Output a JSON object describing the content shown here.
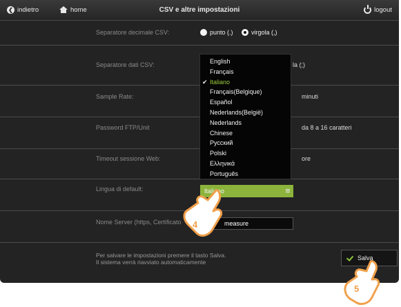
{
  "topbar": {
    "back_label": "indietro",
    "home_label": "home",
    "title": "CSV e altre impostazioni",
    "logout_label": "logout"
  },
  "settings": {
    "decimal_separator": {
      "label": "Separatore decimale CSV:",
      "options": [
        "punto (.)",
        "virgola (,)"
      ],
      "selected": "virgola (,)"
    },
    "data_separator": {
      "label": "Separatore dati CSV:",
      "value_suffix": "la (;)"
    },
    "sample_rate": {
      "label": "Sample Rate:",
      "unit": "minuti"
    },
    "ftp_password": {
      "label": "Password FTP/Unit",
      "hint": "da 8 a 16 caratteri"
    },
    "session_timeout": {
      "label": "Timeout sessione Web:",
      "unit": "ore"
    },
    "default_language": {
      "label": "Lingua di default:",
      "value": "Italiano"
    },
    "server_name": {
      "label": "Nome Server (https, Certificato",
      "value": "measure"
    }
  },
  "language_menu": {
    "items": [
      "English",
      "Français",
      "Italiano",
      "Français(Belgique)",
      "Español",
      "Nederlands(België)",
      "Nederlands",
      "Chinese",
      "Русский",
      "Polski",
      "Ελληνικά",
      "Português"
    ],
    "selected": "Italiano"
  },
  "footer": {
    "note_line1": "Per salvare le impostazioni premere il tasto Salva.",
    "note_line2": "Il sistema verrà riavviato automaticamente",
    "save_label": "Salva"
  },
  "callouts": {
    "step4": "4",
    "step5": "5"
  },
  "colors": {
    "accent_green": "#8cb43c",
    "panel_bg": "#232323",
    "callout_orange": "#f0a04b"
  }
}
